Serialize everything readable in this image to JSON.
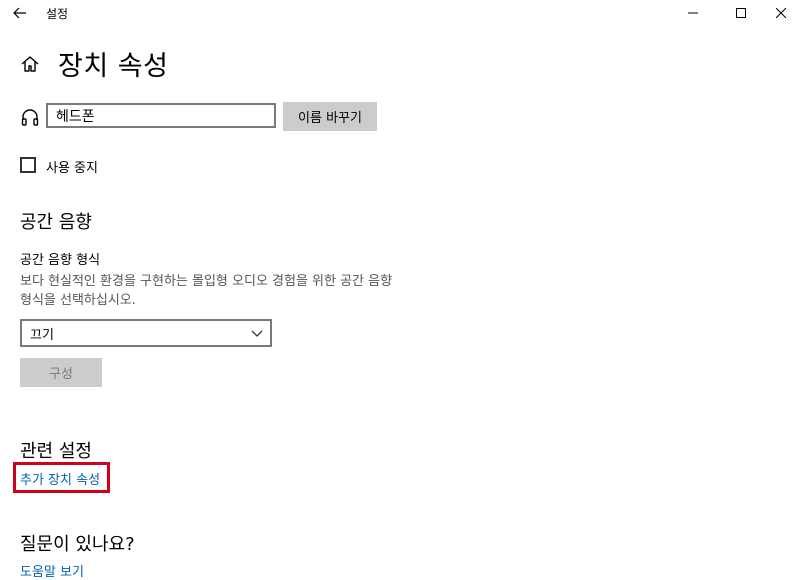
{
  "window": {
    "title": "설정"
  },
  "page": {
    "title": "장치 속성"
  },
  "device": {
    "name_value": "헤드폰",
    "rename_label": "이름 바꾸기",
    "disable_label": "사용 중지"
  },
  "spatial": {
    "section_title": "공간 음향",
    "format_label": "공간 음향 형식",
    "description_line1": "보다 현실적인 환경을 구현하는 몰입형 오디오 경험을 위한 공간 음향",
    "description_line2": "형식을 선택하십시오.",
    "dropdown_value": "끄기",
    "configure_label": "구성"
  },
  "related": {
    "section_title": "관련 설정",
    "link_label": "추가 장치 속성"
  },
  "help": {
    "section_title": "질문이 있나요?",
    "link_label": "도움말 보기"
  },
  "colors": {
    "link": "#0063b1",
    "highlight": "#d0021b",
    "button_bg": "#cccccc"
  }
}
